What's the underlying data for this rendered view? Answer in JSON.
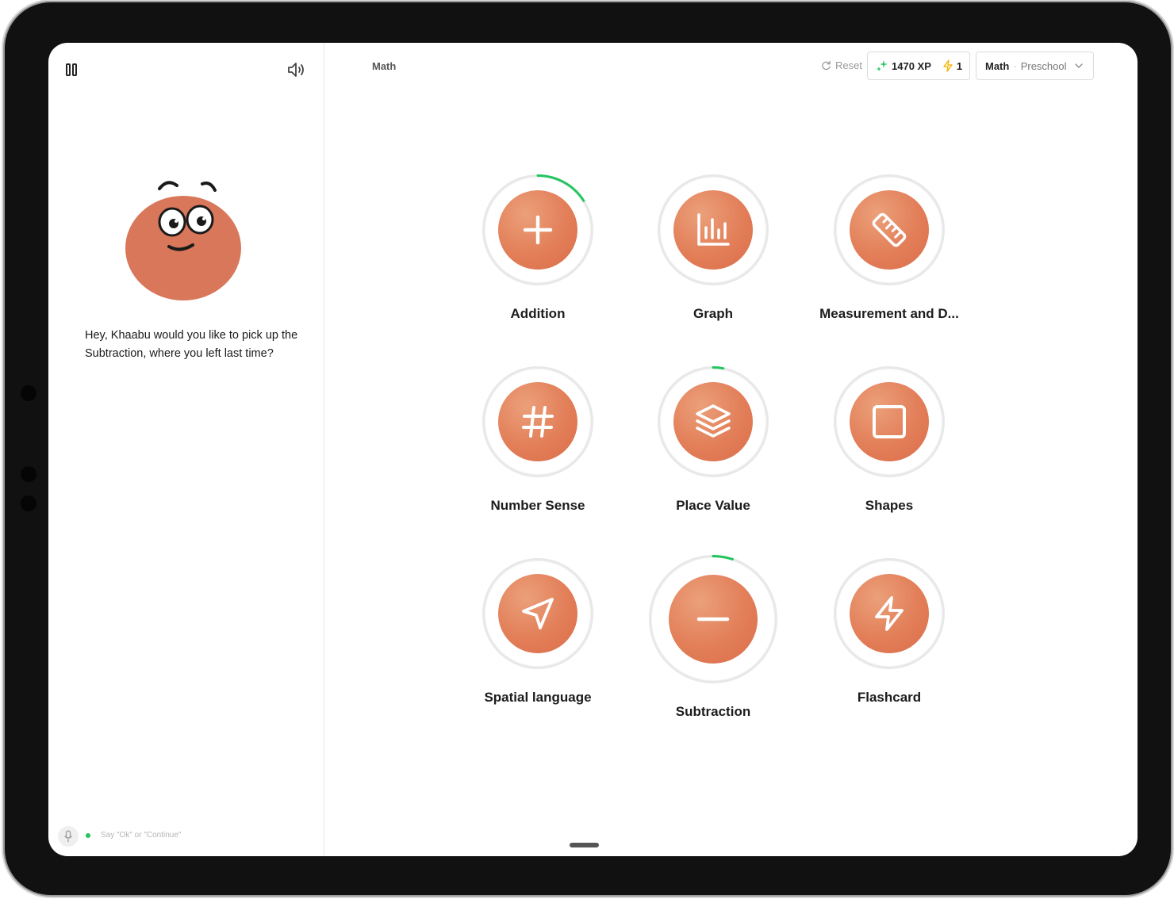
{
  "header": {
    "breadcrumb": "Math",
    "reset_label": "Reset",
    "xp_label": "1470 XP",
    "streak_count": "1",
    "subject": "Math",
    "separator": "·",
    "level": "Preschool"
  },
  "assistant": {
    "message": "Hey, Khaabu would you like to pick up the Subtraction, where you left last time?",
    "voice_hint": "Say \"Ok\" or \"Continue\""
  },
  "colors": {
    "accent": "#e27e58",
    "progress": "#22c55e"
  },
  "topics": [
    {
      "label": "Addition",
      "icon": "plus-icon",
      "progress": 0.16
    },
    {
      "label": "Graph",
      "icon": "bar-chart-icon",
      "progress": 0
    },
    {
      "label": "Measurement and D...",
      "icon": "ruler-icon",
      "progress": 0
    },
    {
      "label": "Number Sense",
      "icon": "hash-icon",
      "progress": 0
    },
    {
      "label": "Place Value",
      "icon": "layers-icon",
      "progress": 0.03
    },
    {
      "label": "Shapes",
      "icon": "square-icon",
      "progress": 0
    },
    {
      "label": "Spatial language",
      "icon": "navigation-icon",
      "progress": 0
    },
    {
      "label": "Subtraction",
      "icon": "minus-icon",
      "progress": 0.05
    },
    {
      "label": "Flashcard",
      "icon": "zap-icon",
      "progress": 0
    }
  ]
}
